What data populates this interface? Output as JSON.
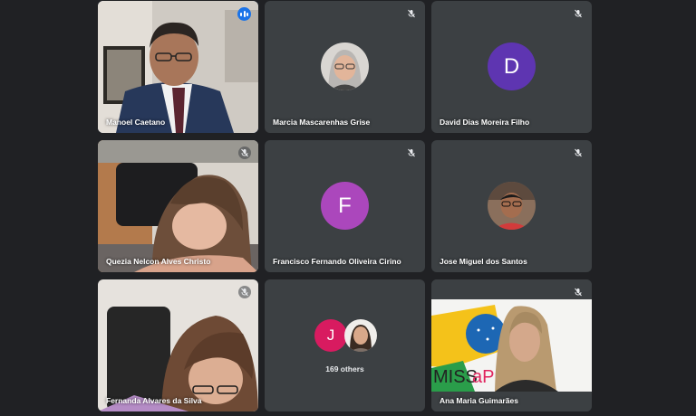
{
  "meeting": {
    "tiles": [
      {
        "name": "Manoel Caetano",
        "mic": "speaking"
      },
      {
        "name": "Marcia Mascarenhas Grise",
        "mic": "muted"
      },
      {
        "name": "David Dias Moreira Filho",
        "mic": "muted",
        "avatar_letter": "D",
        "avatar_color": "#5e35b1"
      },
      {
        "name": "Quezia Nelcon Alves Christo",
        "mic": "muted"
      },
      {
        "name": "Francisco Fernando Oliveira Cirino",
        "mic": "muted",
        "avatar_letter": "F",
        "avatar_color": "#ab47bc"
      },
      {
        "name": "Jose Miguel dos Santos",
        "mic": "muted"
      },
      {
        "name": "Fernanda Alvares da Silva",
        "mic": "muted"
      },
      {
        "others_count_label": "169 others",
        "avatar_letter": "J",
        "avatar_color": "#d81b60"
      },
      {
        "name": "Ana Maria Guimarães",
        "mic": "muted"
      }
    ]
  },
  "icons": {
    "speaking": "audio-level-icon",
    "muted": "mic-off-icon"
  },
  "colors": {
    "background": "#202124",
    "tile": "#3c4043",
    "active_border": "#8ab4f8",
    "speaking_indicator": "#1a73e8"
  }
}
